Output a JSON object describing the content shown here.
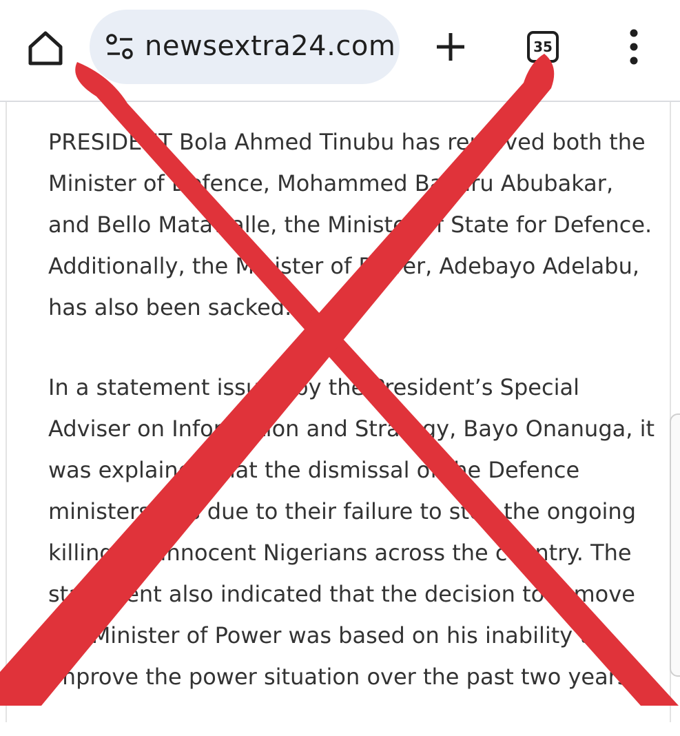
{
  "browser": {
    "url": "newsextra24.com",
    "tab_count": "35",
    "icons": {
      "home": "home-icon",
      "site_settings": "tune-icon",
      "new_tab": "plus-icon",
      "tabs": "tab-switcher-icon",
      "menu": "more-vert-icon"
    }
  },
  "article": {
    "paragraphs": [
      "PRESIDENT Bola Ahmed Tinubu has removed both the Minister of Defence, Mohammed Badaru Abubakar, and Bello Matawalle, the Minister of State for Defence. Additionally, the Minister of Power, Adebayo Adelabu, has also been sacked.",
      "In a statement issued by the President’s Special Adviser on Information and Strategy, Bayo Onanuga, it was explained that the dismissal of the Defence ministers was due to their failure to stop the ongoing killings of innocent Nigerians across the country. The statement also indicated that the decision to remove the Minister of Power was based on his inability to improve the power situation over the past two years"
    ]
  },
  "overlay": {
    "mark": "red-x",
    "color": "#e0333a"
  }
}
